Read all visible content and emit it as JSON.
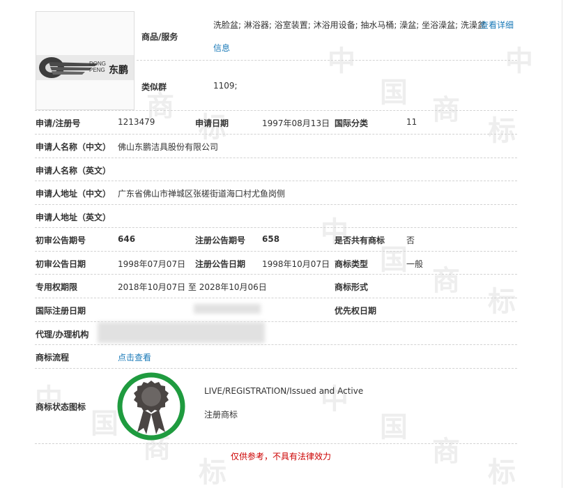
{
  "goods": {
    "label": "商品/服务",
    "value": "洗脸盆; 淋浴器; 浴室装置; 沐浴用设备; 抽水马桶; 澡盆; 坐浴澡盆; 洗澡盆",
    "more_link_1": "查看详细",
    "more_link_2": "信息"
  },
  "similar_group": {
    "label": "类似群",
    "value": "1109;"
  },
  "logo": {
    "latin_top": "DONG",
    "latin_bottom": "PENG",
    "cn": "东鹏"
  },
  "fields": {
    "reg_no_label": "申请/注册号",
    "reg_no": "1213479",
    "apply_date_label": "申请日期",
    "apply_date": "1997年08月13日",
    "intl_class_label": "国际分类",
    "intl_class": "11",
    "applicant_cn_label": "申请人名称（中文）",
    "applicant_cn": "佛山东鹏洁具股份有限公司",
    "applicant_en_label": "申请人名称（英文）",
    "address_cn_label": "申请人地址（中文）",
    "address_cn": "广东省佛山市禅城区张槎街道海口村尤鱼岗侧",
    "address_en_label": "申请人地址（英文）",
    "prelim_no_label": "初审公告期号",
    "prelim_no": "646",
    "reg_pub_no_label": "注册公告期号",
    "reg_pub_no": "658",
    "shared_label": "是否共有商标",
    "shared": "否",
    "prelim_date_label": "初审公告日期",
    "prelim_date": "1998年07月07日",
    "reg_pub_date_label": "注册公告日期",
    "reg_pub_date": "1998年10月07日",
    "mark_type_label": "商标类型",
    "mark_type": "一般",
    "exclusive_label": "专用权期限",
    "exclusive": "2018年10月07日 至 2028年10月06日",
    "form_label": "商标形式",
    "intl_reg_label": "国际注册日期",
    "priority_label": "优先权日期",
    "agent_label": "代理/办理机构",
    "flow_label": "商标流程",
    "flow_link": "点击查看",
    "status_icon_label": "商标状态图标",
    "status_en": "LIVE/REGISTRATION/Issued and Active",
    "status_cn": "注册商标"
  },
  "footer": "仅供参考，不具有法律效力",
  "watermark": [
    "中",
    "国",
    "商",
    "标"
  ],
  "colors": {
    "link": "#1a7ab8",
    "status_ring": "#1f9b3f",
    "footer_text": "#cc0000"
  },
  "icons": {
    "status": "award-ribbon-icon"
  }
}
